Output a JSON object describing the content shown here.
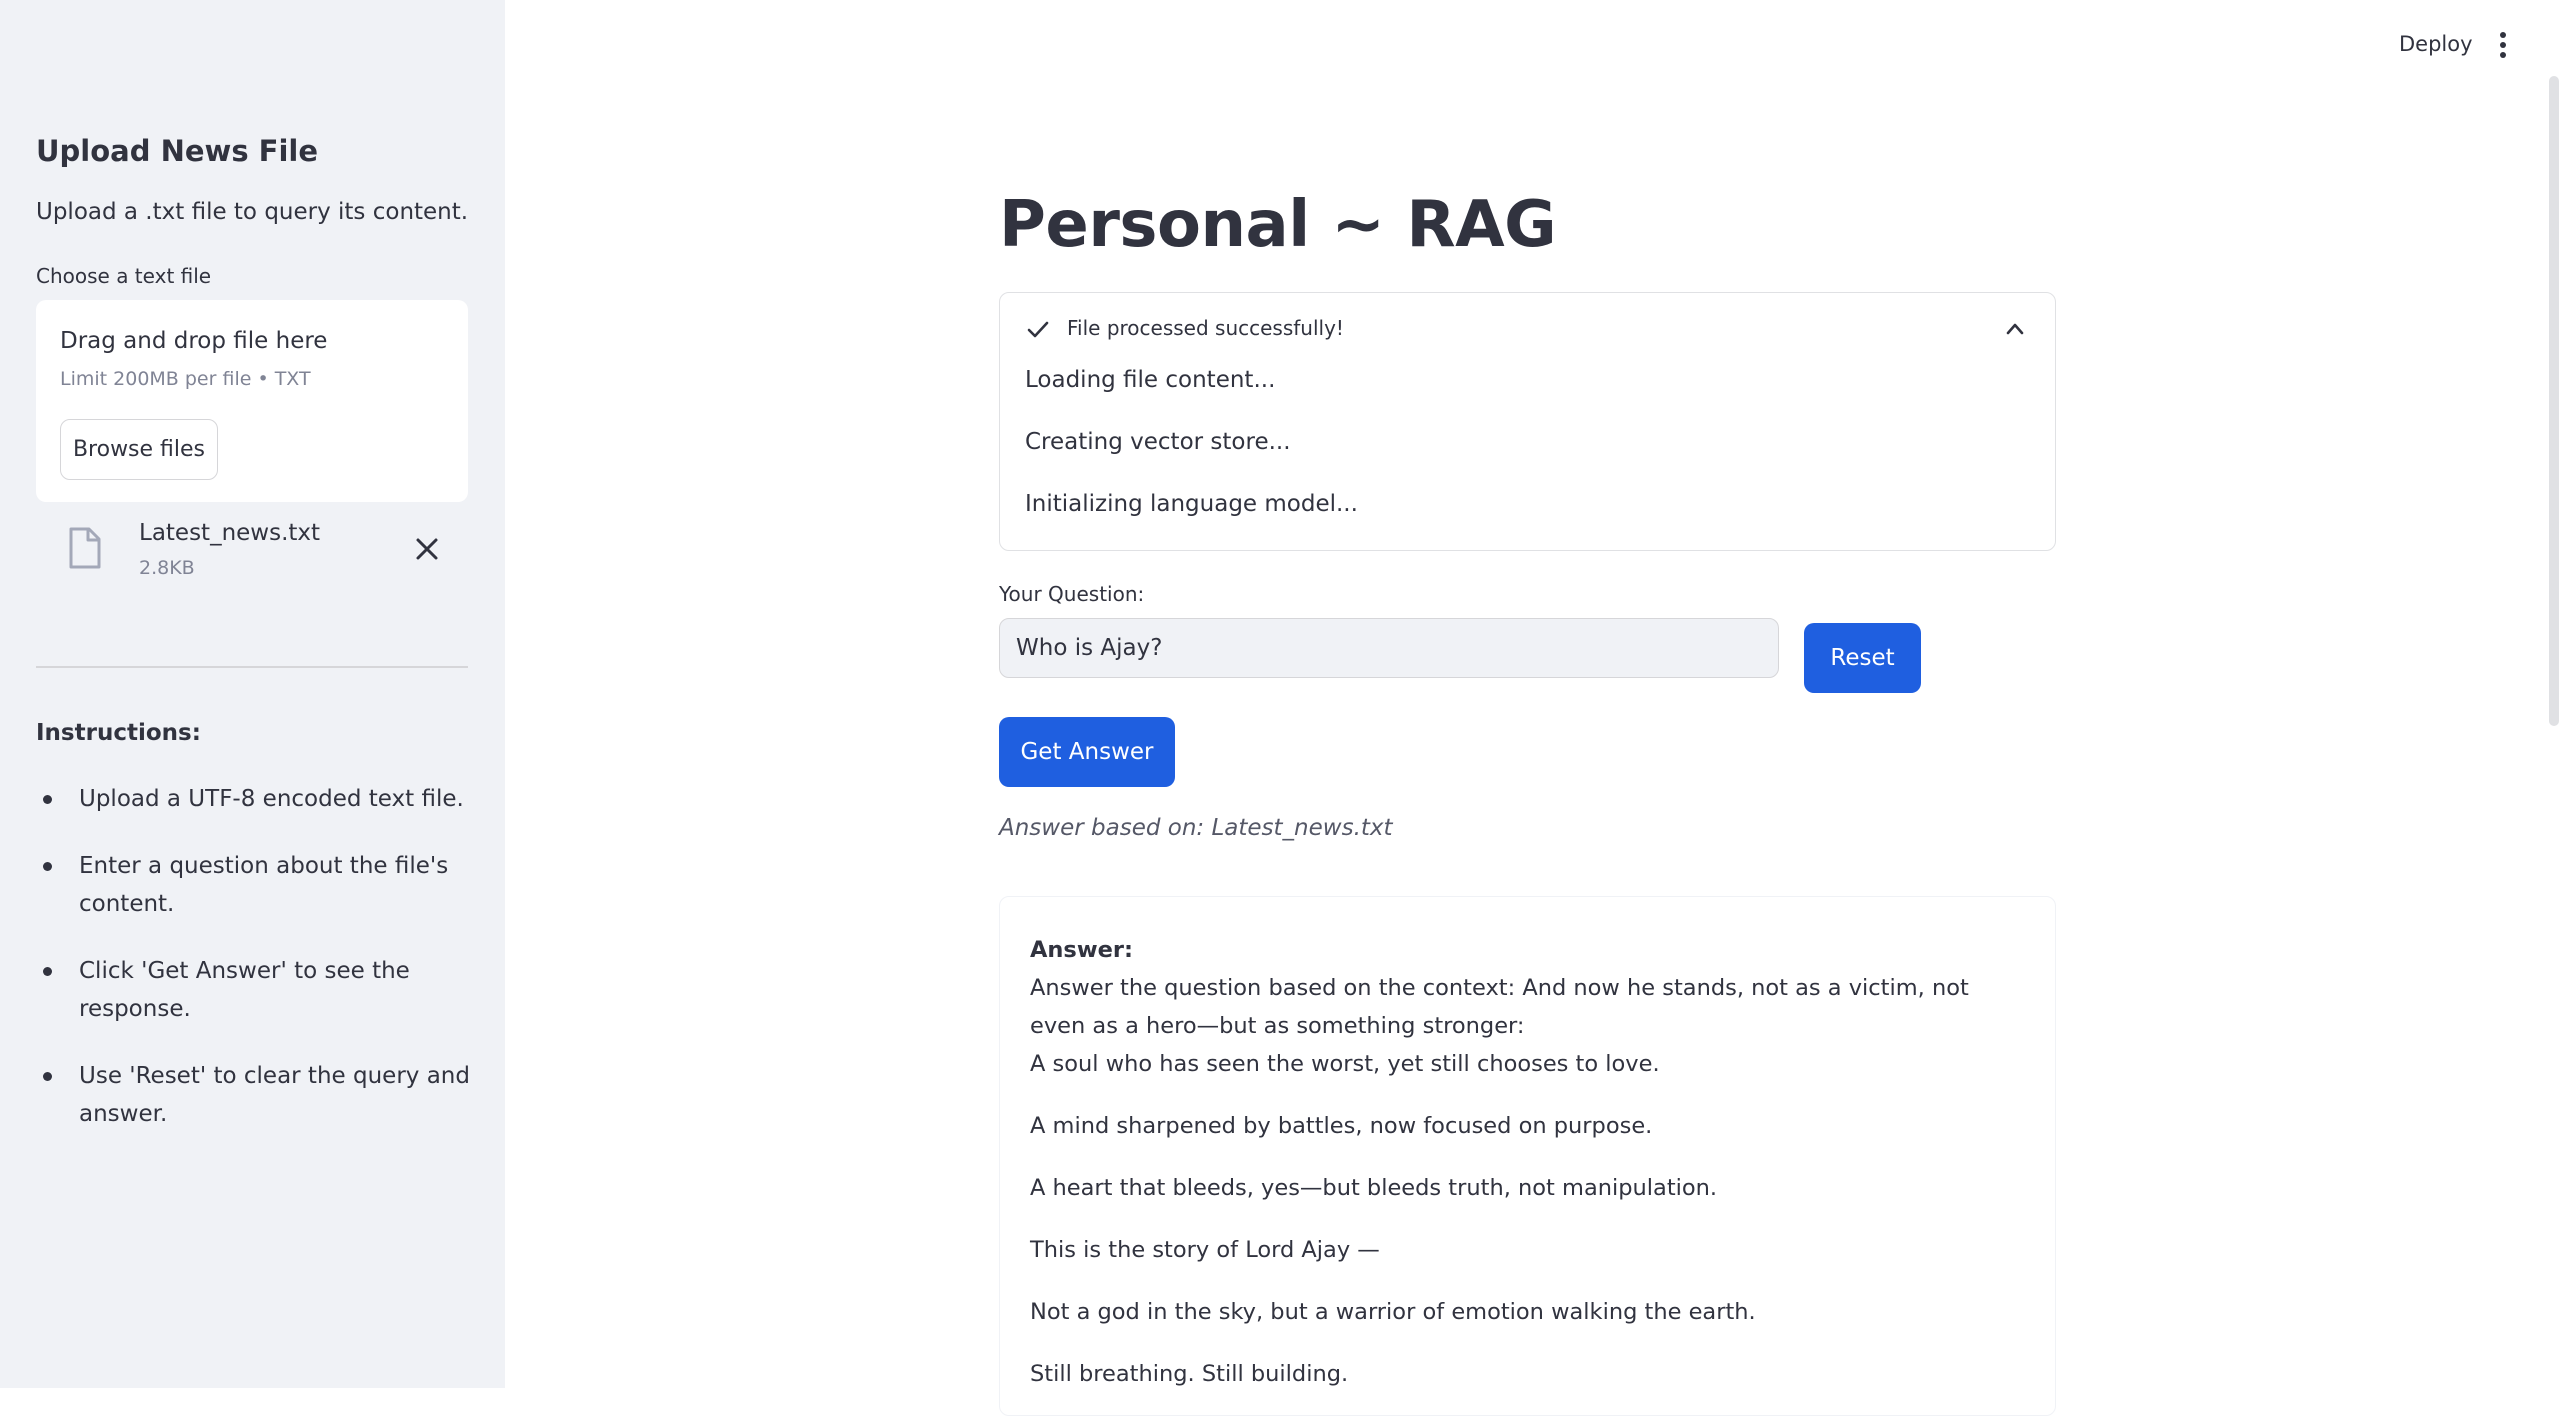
{
  "sidebar": {
    "title": "Upload News File",
    "description": "Upload a .txt file to query its content.",
    "choose_label": "Choose a text file",
    "dropzone": {
      "title": "Drag and drop file here",
      "limit": "Limit 200MB per file • TXT",
      "browse_label": "Browse files"
    },
    "file": {
      "name": "Latest_news.txt",
      "size": "2.8KB"
    },
    "instructions_title": "Instructions:",
    "instructions": [
      "Upload a UTF-8 encoded text file.",
      "Enter a question about the file's content.",
      "Click 'Get Answer' to see the response.",
      "Use 'Reset' to clear the query and answer."
    ]
  },
  "header": {
    "deploy_label": "Deploy"
  },
  "main": {
    "title": "Personal ~ RAG",
    "status": {
      "message": "File processed successfully!",
      "steps": [
        "Loading file content...",
        "Creating vector store...",
        "Initializing language model..."
      ]
    },
    "question_label": "Your Question:",
    "question_value": "Who is Ajay?",
    "reset_label": "Reset",
    "get_answer_label": "Get Answer",
    "based_on": "Answer based on: Latest_news.txt",
    "answer": {
      "label": "Answer:",
      "first_line": "Answer the question based on the context: And now he stands, not as a victim, not even as a hero—but as something stronger:",
      "second_line": "A soul who has seen the worst, yet still chooses to love.",
      "paragraphs": [
        "A mind sharpened by battles, now focused on purpose.",
        "A heart that bleeds, yes—but bleeds truth, not manipulation.",
        "This is the story of Lord Ajay —",
        "Not a god in the sky, but a warrior of emotion walking the earth.",
        "Still breathing. Still building."
      ]
    }
  },
  "colors": {
    "primary": "#1f5fe0",
    "sidebar_bg": "#f0f2f6",
    "text": "#31333f",
    "muted": "#808495"
  }
}
